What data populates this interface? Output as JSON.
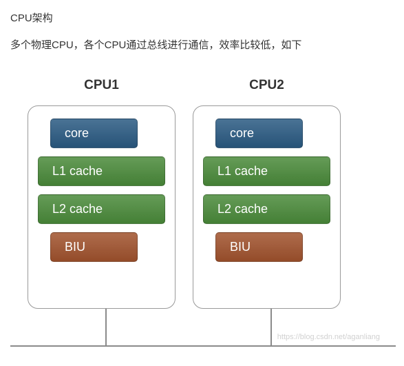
{
  "title": "CPU架构",
  "description": "多个物理CPU，各个CPU通过总线进行通信，效率比较低，如下",
  "cpus": [
    {
      "label": "CPU1",
      "core": "core",
      "l1": "L1 cache",
      "l2": "L2 cache",
      "biu": "BIU"
    },
    {
      "label": "CPU2",
      "core": "core",
      "l1": "L1 cache",
      "l2": "L2 cache",
      "biu": "BIU"
    }
  ],
  "watermark": "https://blog.csdn.net/aganliang",
  "colors": {
    "core": "#2a5a82",
    "cache": "#4a8a3a",
    "biu": "#a0522d",
    "border": "#999",
    "bus": "#8a8a8a"
  }
}
